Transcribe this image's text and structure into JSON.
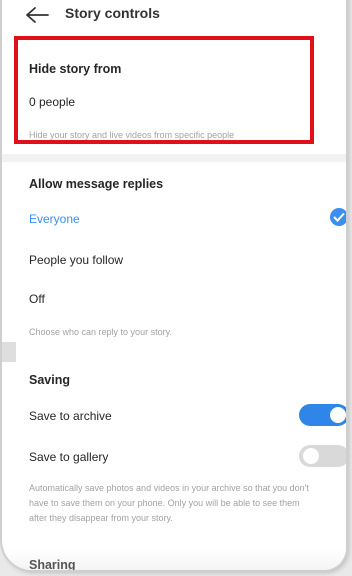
{
  "header": {
    "title": "Story controls"
  },
  "hide_story": {
    "heading": "Hide story from",
    "value": "0 people",
    "description": "Hide your story and live videos from specific people"
  },
  "replies": {
    "heading": "Allow message replies",
    "options": [
      "Everyone",
      "People you follow",
      "Off"
    ],
    "selected": "Everyone",
    "description": "Choose who can reply to your story.",
    "accent_color": "#3a8ff0"
  },
  "saving": {
    "heading": "Saving",
    "archive_label": "Save to archive",
    "archive_on": true,
    "gallery_label": "Save to gallery",
    "gallery_on": false,
    "description_lines": [
      "Automatically save photos and videos in your archive so that you don't",
      "have to save them on your phone. Only you will be able to see them",
      "after they disappear from your story."
    ]
  },
  "next_section_partial": "Sharing",
  "colors": {
    "highlight_box": "#e0101a",
    "toggle_on": "#2f86e8",
    "toggle_off": "#d9d9d9"
  }
}
